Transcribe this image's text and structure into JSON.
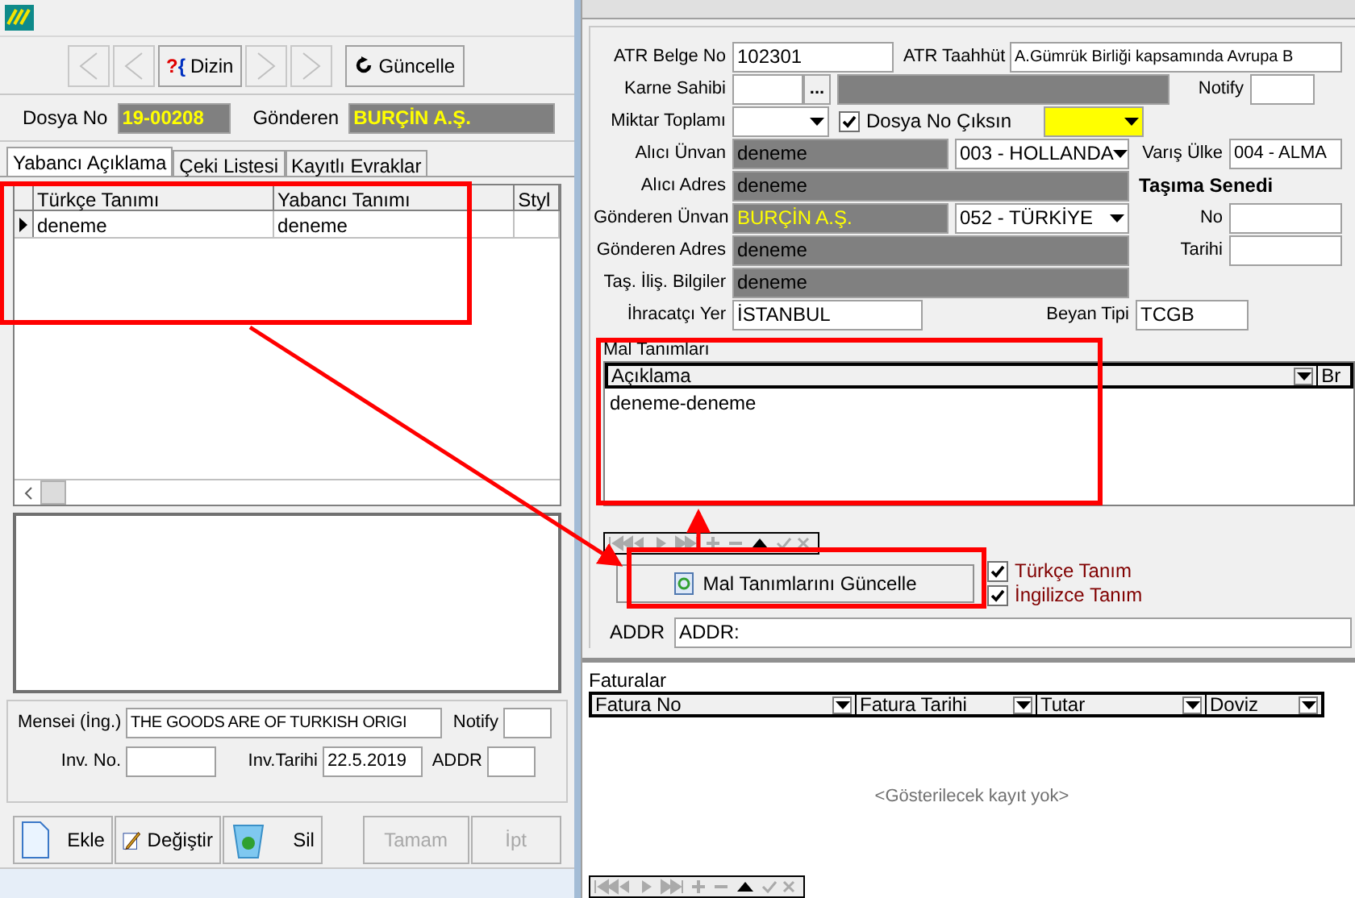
{
  "left": {
    "toolbar": [
      {
        "kind": "first",
        "disabled": true
      },
      {
        "kind": "prev",
        "disabled": true
      },
      {
        "kind": "index",
        "label": "Dizin",
        "glyph_a": "?",
        "glyph_b": "{",
        "disabled": false
      },
      {
        "kind": "next",
        "disabled": true
      },
      {
        "kind": "last",
        "disabled": true
      },
      {
        "kind": "refresh",
        "label": "Güncelle",
        "disabled": false
      }
    ],
    "dosya_label": "Dosya No",
    "dosya_value": "19-00208",
    "gonderen_label": "Gönderen",
    "gonderen_value": "BURÇİN A.Ş.",
    "tabs": [
      {
        "label": "Yabancı Açıklama",
        "selected": true
      },
      {
        "label": "Çeki Listesi",
        "selected": false
      },
      {
        "label": "Kayıtlı Evraklar",
        "selected": false
      }
    ],
    "grid": {
      "columns": [
        "Türkçe Tanımı",
        "Yabancı Tanımı",
        "Styl"
      ],
      "rows": [
        {
          "cells": [
            "deneme",
            "deneme",
            ""
          ],
          "selected": true
        }
      ]
    },
    "fields": [
      {
        "label": "Mensei (İng.)",
        "value": "THE GOODS ARE OF TURKISH ORIGI"
      },
      {
        "label": "Notify"
      },
      {
        "label": "Inv. No."
      },
      {
        "label": "Inv.Tarihi",
        "value": "22.5.2019"
      },
      {
        "label": "ADDR"
      }
    ],
    "buttons": [
      {
        "kind": "add",
        "label": "Ekle",
        "disabled": false
      },
      {
        "kind": "edit",
        "label": "Değiştir",
        "disabled": false
      },
      {
        "kind": "delete",
        "label": "Sil",
        "disabled": false
      },
      {
        "kind": "plain",
        "label": "Tamam",
        "disabled": true
      },
      {
        "kind": "plain",
        "label": "İpt",
        "disabled": true
      }
    ]
  },
  "right": {
    "atr_belge": {
      "label": "ATR Belge No",
      "value": "102301"
    },
    "atr_taahhut": {
      "label": "ATR Taahhüt",
      "value": "A.Gümrük Birliği kapsamında Avrupa B"
    },
    "karne": {
      "label": "Karne Sahibi",
      "button": "..."
    },
    "notify": {
      "label": "Notify"
    },
    "miktar": {
      "label": "Miktar Toplamı"
    },
    "dosya_no_ciksin": {
      "label": "Dosya No Çıksın",
      "checked": true
    },
    "alici_unvan": {
      "label": "Alıcı Ünvan",
      "value": "deneme",
      "country": "003 - HOLLANDA"
    },
    "varis": {
      "label": "Varış Ülke",
      "value": "004 - ALMA"
    },
    "alici_adres": {
      "label": "Alıcı Adres",
      "value": "deneme"
    },
    "tasima": {
      "title": "Taşıma Senedi",
      "no_label": "No",
      "tarihi_label": "Tarihi"
    },
    "gonderen_unvan": {
      "label": "Gönderen Ünvan",
      "value": "BURÇİN A.Ş.",
      "country": "052 - TÜRKİYE"
    },
    "gonderen_adres": {
      "label": "Gönderen Adres",
      "value": "deneme"
    },
    "tas_ilis": {
      "label": "Taş. İliş. Bilgiler",
      "value": "deneme"
    },
    "ihracatci": {
      "label": "İhracatçı Yer",
      "value": "İSTANBUL"
    },
    "beyan": {
      "label": "Beyan Tipi",
      "value": "TCGB"
    },
    "mal": {
      "title": "Mal Tanımları",
      "columns": [
        "Açıklama",
        "Br"
      ],
      "rows": [
        "deneme-deneme"
      ]
    },
    "update_button": "Mal Tanımlarını Güncelle",
    "options": [
      {
        "label": "Türkçe Tanım",
        "checked": true
      },
      {
        "label": "İngilizce Tanım",
        "checked": true
      }
    ],
    "addr": {
      "label": "ADDR",
      "value": "ADDR:"
    },
    "faturalar": {
      "title": "Faturalar",
      "columns": [
        "Fatura No",
        "Fatura Tarihi",
        "Tutar",
        "Doviz"
      ],
      "empty": "<Gösterilecek kayıt yok>"
    }
  }
}
